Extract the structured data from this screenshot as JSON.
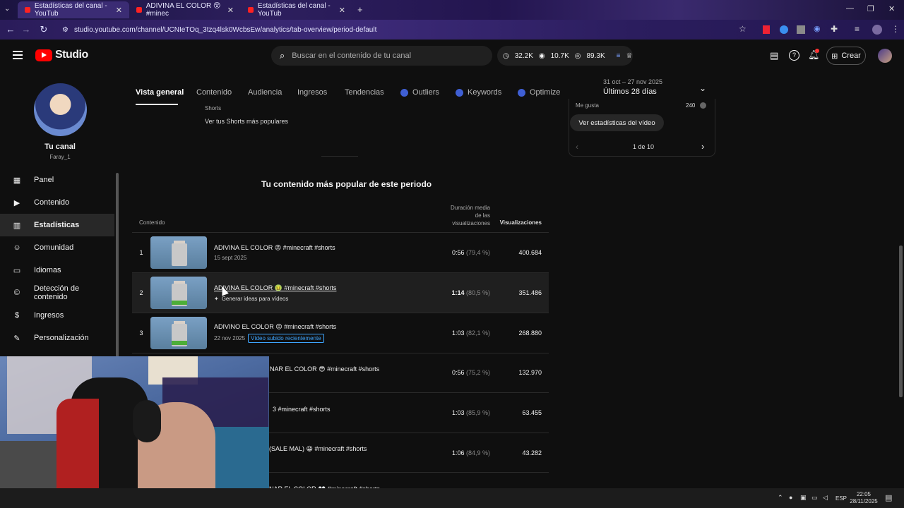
{
  "browser": {
    "tabs": [
      {
        "title": "Estadísticas del canal - YouTub"
      },
      {
        "title": "ADIVINA EL COLOR 😵 #minec"
      },
      {
        "title": "Estadísticas del canal - YouTub"
      }
    ],
    "url": "studio.youtube.com/channel/UCNIeTOq_3tzq4lsk0WcbsEw/analytics/tab-overview/period-default"
  },
  "header": {
    "logo_text": "Studio",
    "search_placeholder": "Buscar en el contenido de tu canal",
    "stats": [
      "32.2K",
      "10.7K",
      "89.3K"
    ],
    "create_label": "Crear"
  },
  "sidebar": {
    "channel_title": "Tu canal",
    "channel_name": "Faray_1",
    "items": [
      {
        "label": "Panel",
        "icon": "dashboard-icon"
      },
      {
        "label": "Contenido",
        "icon": "content-icon"
      },
      {
        "label": "Estadísticas",
        "icon": "analytics-icon",
        "active": true
      },
      {
        "label": "Comunidad",
        "icon": "community-icon"
      },
      {
        "label": "Idiomas",
        "icon": "languages-icon"
      },
      {
        "label": "Detección de contenido",
        "icon": "copyright-icon"
      },
      {
        "label": "Ingresos",
        "icon": "earn-icon"
      },
      {
        "label": "Personalización",
        "icon": "customization-icon"
      }
    ]
  },
  "tabs": [
    {
      "label": "Vista general",
      "active": true
    },
    {
      "label": "Contenido"
    },
    {
      "label": "Audiencia"
    },
    {
      "label": "Ingresos"
    },
    {
      "label": "Tendencias"
    },
    {
      "label": "Outliers"
    },
    {
      "label": "Keywords"
    },
    {
      "label": "Optimize"
    }
  ],
  "period": {
    "range": "31 oct – 27 nov 2025",
    "label": "Últimos 28 días"
  },
  "shorts_section": {
    "title": "Shorts",
    "link": "Ver tus Shorts más populares"
  },
  "right_card": {
    "likes_label": "Me gusta",
    "likes_value": "240",
    "button": "Ver estadísticas del vídeo",
    "pager": "1 de 10"
  },
  "top_content": {
    "heading": "Tu contenido más popular de este periodo",
    "col_content": "Contenido",
    "col_duration": "Duración media de las visualizaciones",
    "col_views": "Visualizaciones",
    "rows": [
      {
        "rank": "1",
        "title": "ADIVINA EL COLOR 😡 #minecraft #shorts",
        "date": "15 sept 2025",
        "duration": "0:56",
        "pct": "(79,4 %)",
        "views": "400.684"
      },
      {
        "rank": "2",
        "title": "ADIVINA EL COLOR 🤢 #minecraft #shorts",
        "hover_label": "Generar ideas para vídeos",
        "duration": "1:14",
        "pct": "(80,5 %)",
        "views": "351.486"
      },
      {
        "rank": "3",
        "title": "ADIVINO EL COLOR 😡 #minecraft #shorts",
        "date": "22 nov 2025",
        "badge": "Vídeo subido recientemente",
        "duration": "1:03",
        "pct": "(82,1 %)",
        "views": "268.880"
      },
      {
        "title": "NAR EL COLOR 😎 #minecraft #shorts",
        "duration": "0:56",
        "pct": "(75,2 %)",
        "views": "132.970"
      },
      {
        "title": "3 #minecraft #shorts",
        "duration": "1:03",
        "pct": "(85,9 %)",
        "views": "63.455"
      },
      {
        "title": "(SALE MAL) 😀 #minecraft #shorts",
        "duration": "1:06",
        "pct": "(84,9 %)",
        "views": "43.282"
      },
      {
        "title": "NAR EL COLOR 👀 #minecraft #shorts"
      }
    ]
  },
  "taskbar": {
    "lang": "ESP",
    "time": "22:05",
    "date": "28/11/2025"
  }
}
